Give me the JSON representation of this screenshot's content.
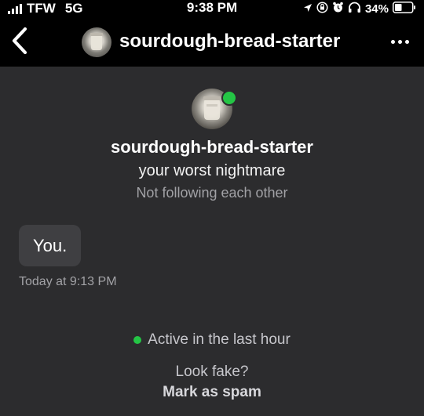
{
  "status_bar": {
    "carrier": "TFW",
    "network": "5G",
    "time": "9:38 PM",
    "battery": "34%"
  },
  "header": {
    "username": "sourdough-bread-starter",
    "back_icon": "chevron-left-icon",
    "more_icon": "ellipsis-icon"
  },
  "profile": {
    "name": "sourdough-bread-starter",
    "subtitle": "your worst nightmare",
    "relation": "Not following each other",
    "online": true
  },
  "messages": [
    {
      "text": "You.",
      "time": "Today at 9:13 PM"
    }
  ],
  "footer": {
    "active_status": "Active in the last hour",
    "look_fake": "Look fake?",
    "spam_label": "Mark as spam"
  },
  "colors": {
    "background": "#2c2c2e",
    "header_bg": "#000000",
    "bubble_bg": "#3f3f42",
    "online_green": "#24c545",
    "muted_text": "#a2a2a6"
  }
}
